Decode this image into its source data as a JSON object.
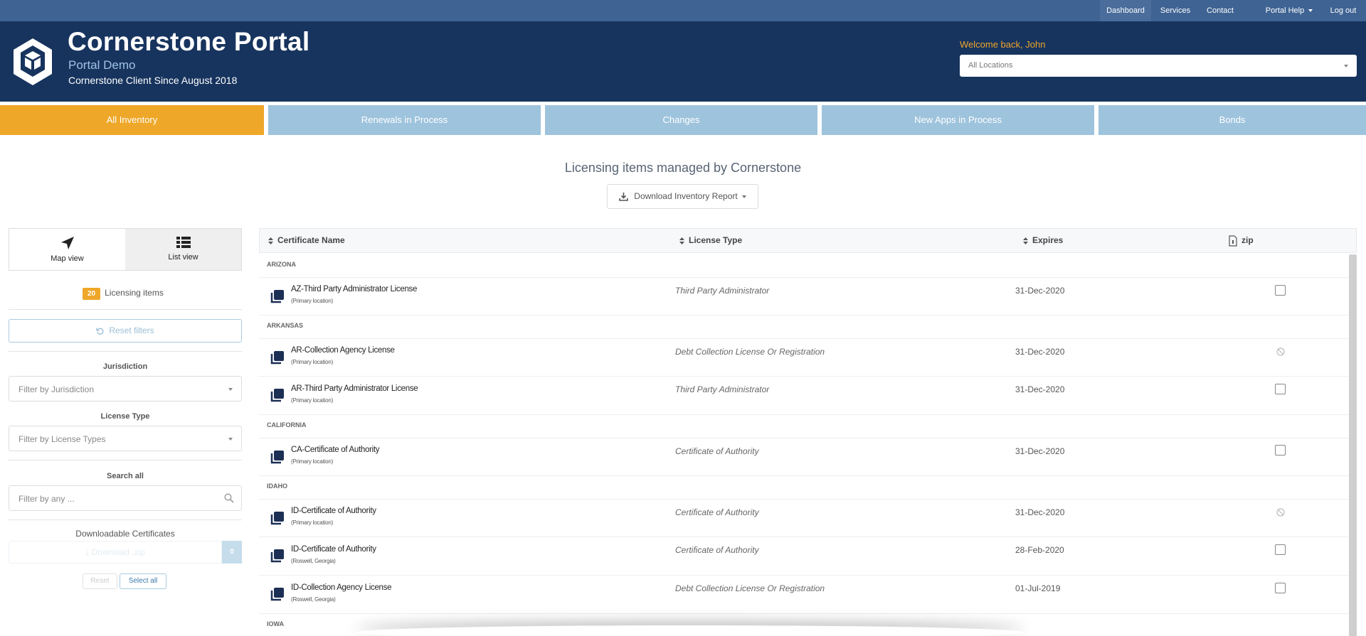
{
  "topnav": {
    "dashboard": "Dashboard",
    "services": "Services",
    "contact": "Contact",
    "portal_help": "Portal Help",
    "logout": "Log out"
  },
  "header": {
    "title": "Cornerstone Portal",
    "subtitle": "Portal Demo",
    "since": "Cornerstone Client Since August 2018",
    "welcome": "Welcome back, John",
    "location_select": "All Locations"
  },
  "tabs": [
    "All Inventory",
    "Renewals in Process",
    "Changes",
    "New Apps in Process",
    "Bonds"
  ],
  "main": {
    "heading": "Licensing items managed by Cornerstone",
    "download_report": "Download Inventory Report"
  },
  "sidebar": {
    "map_view": "Map view",
    "list_view": "List view",
    "count": "20",
    "count_label": "Licensing items",
    "reset_filters": "Reset filters",
    "jurisdiction_label": "Jurisdiction",
    "jurisdiction_placeholder": "Filter by Jurisdiction",
    "license_type_label": "License Type",
    "license_type_placeholder": "Filter by License Types",
    "search_label": "Search all",
    "search_placeholder": "Filter by any ...",
    "downloadable_label": "Downloadable Certificates",
    "download_zip": "Download .zip",
    "download_count": "0",
    "reset": "Reset",
    "select_all": "Select all"
  },
  "table": {
    "columns": {
      "certificate": "Certificate Name",
      "license_type": "License Type",
      "expires": "Expires",
      "zip": "zip"
    },
    "groups": {
      "arizona": "ARIZONA",
      "arkansas": "ARKANSAS",
      "california": "CALIFORNIA",
      "idaho": "IDAHO",
      "iowa": "IOWA"
    },
    "rows": [
      {
        "name": "AZ-Third Party Administrator License",
        "location": "(Primary location)",
        "type": "Third Party Administrator",
        "expires": "31-Dec-2020",
        "zip": "checkbox"
      },
      {
        "name": "AR-Collection Agency License",
        "location": "(Primary location)",
        "type": "Debt Collection License Or Registration",
        "expires": "31-Dec-2020",
        "zip": "unavailable"
      },
      {
        "name": "AR-Third Party Administrator License",
        "location": "(Primary location)",
        "type": "Third Party Administrator",
        "expires": "31-Dec-2020",
        "zip": "checkbox"
      },
      {
        "name": "CA-Certificate of Authority",
        "location": "(Primary location)",
        "type": "Certificate of Authority",
        "expires": "31-Dec-2020",
        "zip": "checkbox"
      },
      {
        "name": "ID-Certificate of Authority",
        "location": "(Primary location)",
        "type": "Certificate of Authority",
        "expires": "31-Dec-2020",
        "zip": "unavailable"
      },
      {
        "name": "ID-Certificate of Authority",
        "location": "(Roswell, Georgia)",
        "type": "Certificate of Authority",
        "expires": "28-Feb-2020",
        "zip": "checkbox"
      },
      {
        "name": "ID-Collection Agency License",
        "location": "(Roswell, Georgia)",
        "type": "Debt Collection License Or Registration",
        "expires": "01-Jul-2019",
        "zip": "checkbox"
      }
    ]
  },
  "colors": {
    "navy": "#17345e",
    "topbar": "#3f6393",
    "accent_orange": "#eea728",
    "tab_blue": "#9ec3dd"
  }
}
